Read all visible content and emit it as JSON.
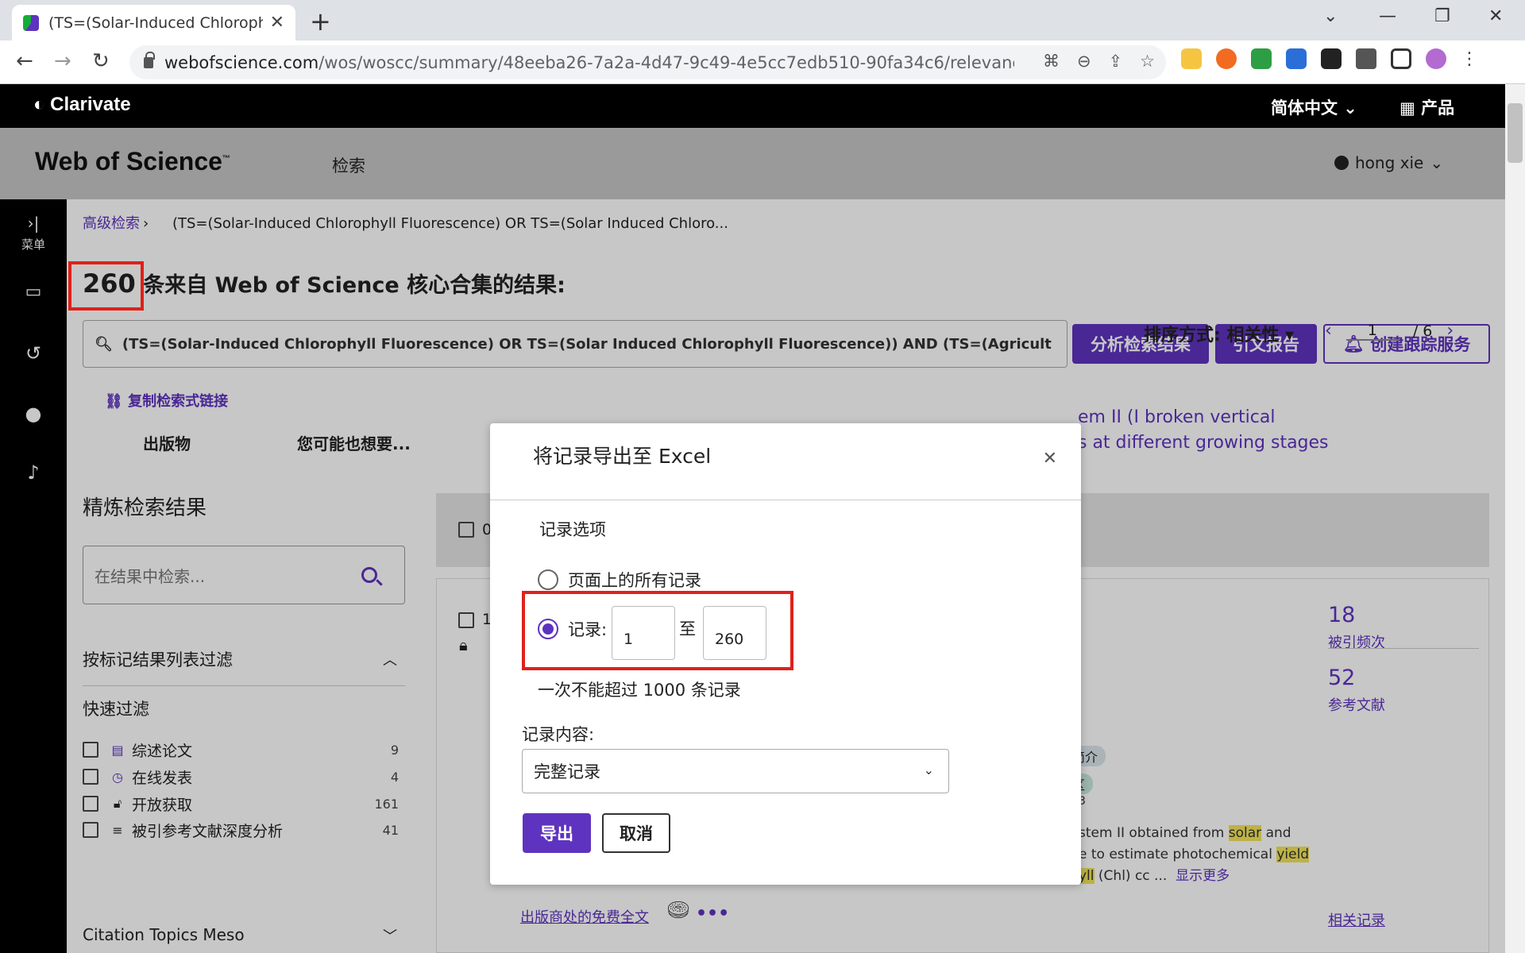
{
  "browser": {
    "tab_title": "(TS=(Solar-Induced Chlorophyll",
    "url_host": "webofscience.com",
    "url_path": "/wos/woscc/summary/48eeba26-7a2a-4d47-9c49-4e5cc7edb510-90fa34c6/relevanc..."
  },
  "site_header": {
    "brand": "Clarivate",
    "language": "简体中文",
    "products": "产品"
  },
  "wos_header": {
    "logo": "Web of Science",
    "logo_tm": "™",
    "nav_search": "检索",
    "user": "hong xie"
  },
  "rail": {
    "menu_label": "菜单"
  },
  "breadcrumb": {
    "advanced": "高级检索",
    "query": "(TS=(Solar-Induced Chlorophyll Fluorescence) OR TS=(Solar Induced Chloro..."
  },
  "results": {
    "count": "260",
    "heading_suffix": "条来自 Web of Science 核心合集的结果:",
    "query": "(TS=(Solar-Induced Chlorophyll Fluorescence) OR TS=(Solar Induced Chlorophyll Fluorescence)) AND (TS=(Agriculture) OR T...",
    "analyze_button": "分析检索结果",
    "citation_report_button": "引文报告",
    "create_alert_button": "创建跟踪服务",
    "copy_link": "复制检索式链接",
    "tab_publications": "出版物",
    "tab_you_may_like": "您可能也想要..."
  },
  "refine": {
    "title": "精炼检索结果",
    "search_placeholder": "在结果中检索...",
    "filter_header": "按标记结果列表过滤",
    "quick_filter_title": "快速过滤",
    "quick_filters": [
      {
        "label": "综述论文",
        "count": "9",
        "icon": "document-icon"
      },
      {
        "label": "在线发表",
        "count": "4",
        "icon": "clock-icon"
      },
      {
        "label": "开放获取",
        "count": "161",
        "icon": "unlock-icon"
      },
      {
        "label": "被引参考文献深度分析",
        "count": "41",
        "icon": "list-star-icon"
      }
    ],
    "citation_topics": "Citation Topics Meso"
  },
  "toolbar": {
    "selected_prefix": "0",
    "sort": "排序方式: 相关性",
    "page_current": "1",
    "page_total": "/ 6"
  },
  "record": {
    "index": "1",
    "title_line1": "em II (I broken vertical",
    "title_line2": "s at different growing stages",
    "times_cited": "18",
    "times_cited_label": "被引频次",
    "references": "52",
    "references_label": "参考文献",
    "badge1": "简介",
    "badge2": "区",
    "badge_sub": "3",
    "abstract_l1_a": "stem II obtained from ",
    "abstract_l1_hl": "solar",
    "abstract_l1_b": " and",
    "abstract_l2_a": "e to estimate photochemical ",
    "abstract_l2_hl": "yield",
    "abstract_l3_hl": "yll",
    "abstract_l3_b": " (Chl) cc ...",
    "show_more": "显示更多",
    "free_fulltext": "出版商处的免费全文",
    "related": "相关记录"
  },
  "modal": {
    "title": "将记录导出至 Excel",
    "section": "记录选项",
    "option_all": "页面上的所有记录",
    "option_range": "记录:",
    "range_from": "1",
    "range_to_label": "至",
    "range_to": "260",
    "limit_note": "一次不能超过 1000 条记录",
    "content_label": "记录内容:",
    "content_value": "完整记录",
    "export_button": "导出",
    "cancel_button": "取消"
  },
  "colors": {
    "brand_purple": "#5e33bf",
    "highlight_red": "#e0201b",
    "highlight_yellow": "#f2e55a"
  }
}
